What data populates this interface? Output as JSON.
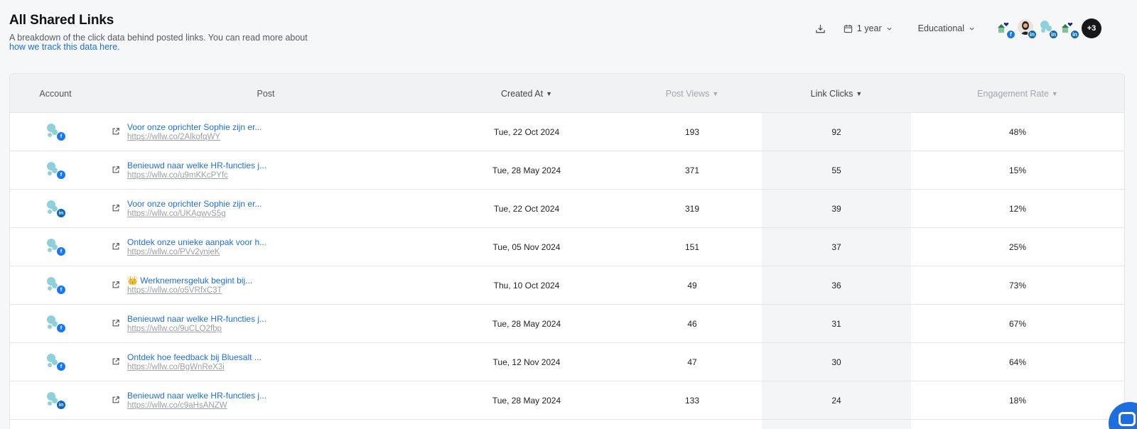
{
  "header": {
    "title": "All Shared Links",
    "subtitle": "A breakdown of the click data behind posted links. You can read more about",
    "subtitle_link": "how we track this data here."
  },
  "toolbar": {
    "download_icon": "download-icon",
    "date_range": "1 year",
    "category": "Educational",
    "more_accounts": "+3"
  },
  "table": {
    "headers": {
      "account": "Account",
      "post": "Post",
      "created_at": "Created At",
      "post_views": "Post Views",
      "link_clicks": "Link Clicks",
      "engagement_rate": "Engagement Rate"
    },
    "sort_indicator": "▼",
    "rows": [
      {
        "network": "facebook",
        "title": "Voor onze oprichter Sophie zijn er...",
        "url": "https://wllw.co/2AlkofqWY",
        "created": "Tue, 22 Oct 2024",
        "views": "193",
        "clicks": "92",
        "rate": "48%"
      },
      {
        "network": "facebook",
        "title": "Benieuwd naar welke HR-functies j...",
        "url": "https://wllw.co/u9mKKcPYfc",
        "created": "Tue, 28 May 2024",
        "views": "371",
        "clicks": "55",
        "rate": "15%"
      },
      {
        "network": "linkedin",
        "title": "Voor onze oprichter Sophie zijn er...",
        "url": "https://wllw.co/UKAgwvS5g",
        "created": "Tue, 22 Oct 2024",
        "views": "319",
        "clicks": "39",
        "rate": "12%"
      },
      {
        "network": "facebook",
        "title": "Ontdek onze unieke aanpak voor h...",
        "url": "https://wllw.co/PVv2ynjeK",
        "created": "Tue, 05 Nov 2024",
        "views": "151",
        "clicks": "37",
        "rate": "25%"
      },
      {
        "network": "facebook",
        "title": "👑 Werknemersgeluk begint bij...",
        "url": "https://wllw.co/o5VRfxC3T",
        "created": "Thu, 10 Oct 2024",
        "views": "49",
        "clicks": "36",
        "rate": "73%"
      },
      {
        "network": "facebook",
        "title": "Benieuwd naar welke HR-functies j...",
        "url": "https://wllw.co/9uCLQ2fbp",
        "created": "Tue, 28 May 2024",
        "views": "46",
        "clicks": "31",
        "rate": "67%"
      },
      {
        "network": "facebook",
        "title": "Ontdek hoe feedback bij Bluesalt ...",
        "url": "https://wllw.co/BgWnReX3i",
        "created": "Tue, 12 Nov 2024",
        "views": "47",
        "clicks": "30",
        "rate": "64%"
      },
      {
        "network": "linkedin",
        "title": "Benieuwd naar welke HR-functies j...",
        "url": "https://wllw.co/c9aHsANZW",
        "created": "Tue, 28 May 2024",
        "views": "133",
        "clicks": "24",
        "rate": "18%"
      }
    ]
  },
  "colors": {
    "link": "#1d6fe0",
    "facebook": "#1877f2",
    "linkedin": "#0a66c2",
    "highlight_column": "#f4f5f6"
  }
}
